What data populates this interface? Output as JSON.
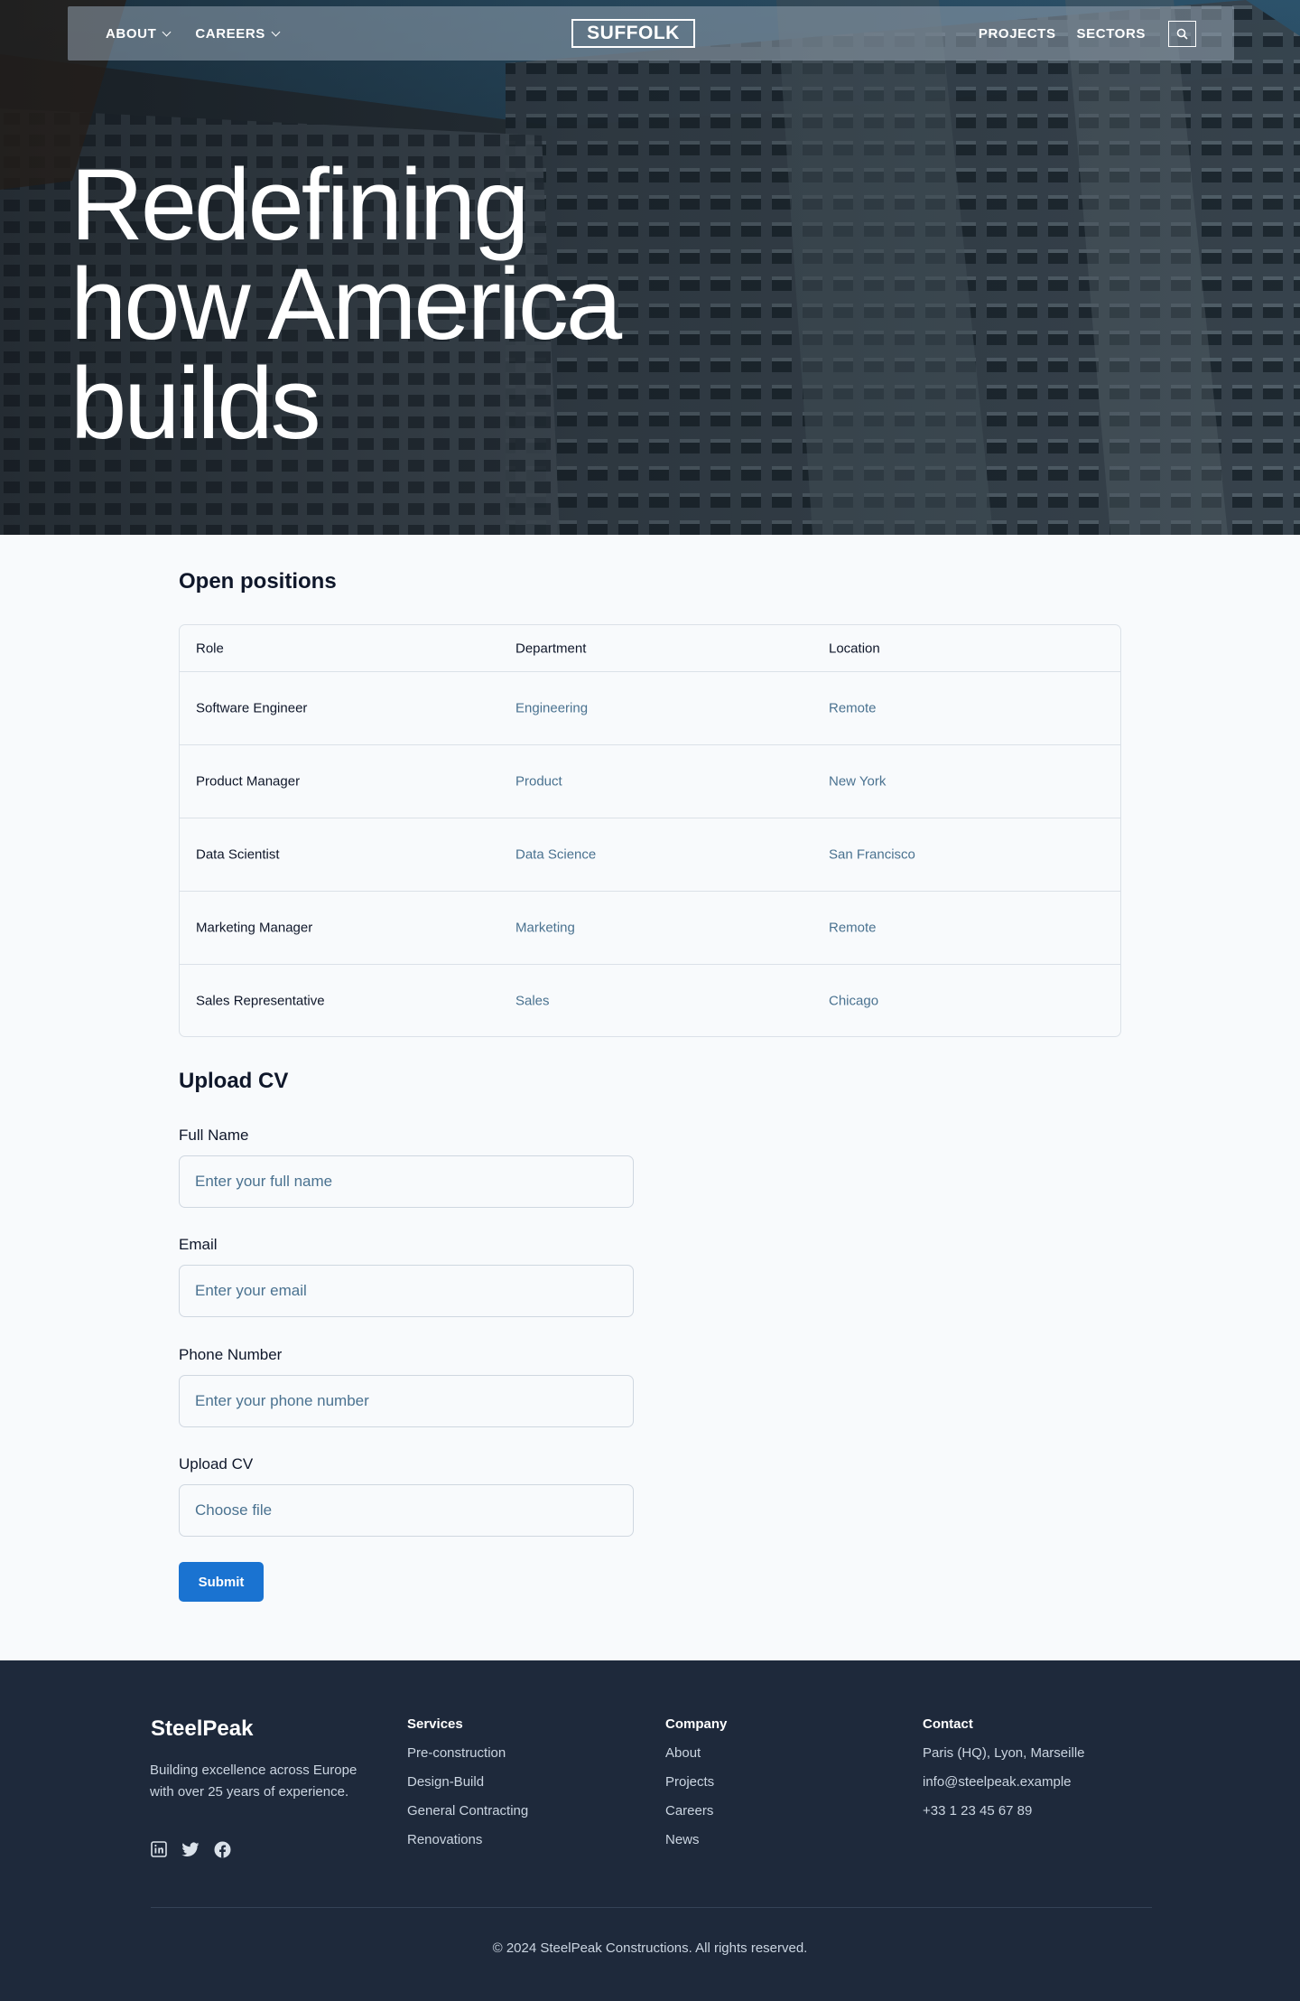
{
  "header": {
    "nav_left": [
      {
        "label": "ABOUT"
      },
      {
        "label": "CAREERS"
      }
    ],
    "logo_text": "SUFFOLK",
    "nav_right": [
      {
        "label": "PROJECTS"
      },
      {
        "label": "SECTORS"
      }
    ],
    "search_icon": "search-icon"
  },
  "hero": {
    "title_lines": [
      "Redefining",
      "how America",
      "builds"
    ]
  },
  "positions": {
    "title": "Open positions",
    "columns": [
      "Role",
      "Department",
      "Location"
    ],
    "rows": [
      {
        "role": "Software Engineer",
        "department": "Engineering",
        "location": "Remote"
      },
      {
        "role": "Product Manager",
        "department": "Product",
        "location": "New York"
      },
      {
        "role": "Data Scientist",
        "department": "Data Science",
        "location": "San Francisco"
      },
      {
        "role": "Marketing Manager",
        "department": "Marketing",
        "location": "Remote"
      },
      {
        "role": "Sales Representative",
        "department": "Sales",
        "location": "Chicago"
      }
    ]
  },
  "upload_form": {
    "title": "Upload CV",
    "full_name": {
      "label": "Full Name",
      "placeholder": "Enter your full name"
    },
    "email": {
      "label": "Email",
      "placeholder": "Enter your email"
    },
    "phone": {
      "label": "Phone Number",
      "placeholder": "Enter your phone number"
    },
    "cv": {
      "label": "Upload CV",
      "button_text": "Choose file"
    },
    "submit_label": "Submit"
  },
  "footer": {
    "brand": "SteelPeak",
    "description": "Building excellence across Europe with over 25 years of experience.",
    "social_icons": [
      "linkedin-icon",
      "twitter-icon",
      "facebook-icon"
    ],
    "services": {
      "title": "Services",
      "items": [
        "Pre-construction",
        "Design-Build",
        "General Contracting",
        "Renovations"
      ]
    },
    "company": {
      "title": "Company",
      "items": [
        "About",
        "Projects",
        "Careers",
        "News"
      ]
    },
    "contact": {
      "title": "Contact",
      "items": [
        "Paris (HQ), Lyon, Marseille",
        "info@steelpeak.example",
        "+33 1 23 45 67 89"
      ]
    },
    "copyright": "© 2024 SteelPeak Constructions. All rights reserved."
  },
  "colors": {
    "accent": "#1a73d1",
    "link": "#4a7290",
    "footer_bg": "#1e293b",
    "page_bg": "#f8fafc"
  }
}
